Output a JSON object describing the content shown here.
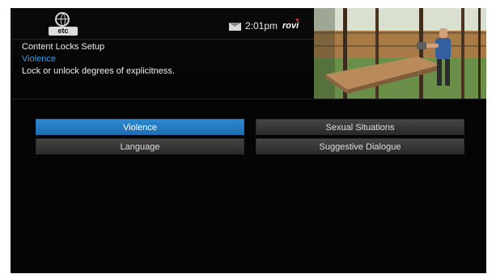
{
  "header": {
    "logo_text": "etc",
    "time": "2:01pm",
    "brand": "rovi",
    "title": "Content Locks Setup",
    "subtitle": "Violence",
    "description": "Lock or unlock degrees of explicitness."
  },
  "options": [
    {
      "label": "Violence",
      "selected": true
    },
    {
      "label": "Sexual Situations",
      "selected": false
    },
    {
      "label": "Language",
      "selected": false
    },
    {
      "label": "Suggestive Dialogue",
      "selected": false
    }
  ],
  "colors": {
    "accent": "#2d88d1",
    "subtitle": "#3b9be4",
    "background": "#050505"
  }
}
